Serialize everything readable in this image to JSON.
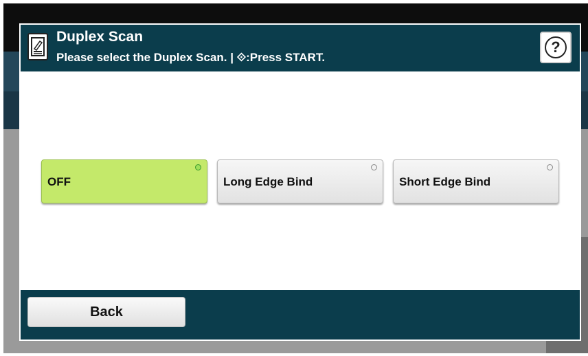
{
  "header": {
    "icon": "document-edit-icon",
    "title": "Duplex Scan",
    "subtitle": "Please select the Duplex Scan. | ⟐:Press START.",
    "help_label": "?"
  },
  "options": [
    {
      "label": "OFF",
      "selected": true
    },
    {
      "label": "Long Edge Bind",
      "selected": false
    },
    {
      "label": "Short Edge Bind",
      "selected": false
    }
  ],
  "footer": {
    "back_label": "Back"
  },
  "colors": {
    "header_bg": "#0b3d4c",
    "selected_bg": "#c4e96a"
  }
}
